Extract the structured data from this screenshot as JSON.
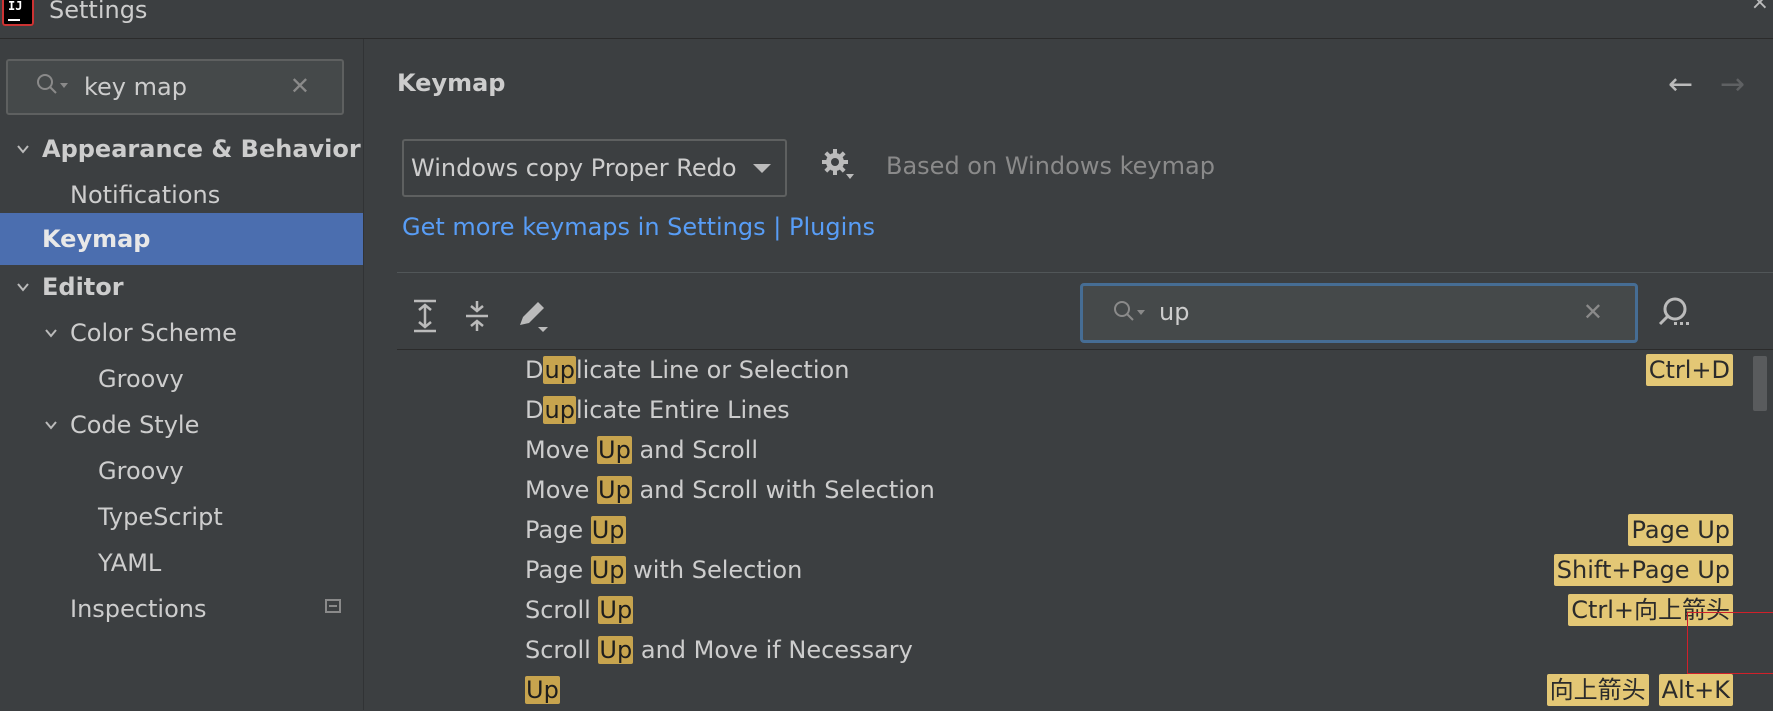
{
  "window": {
    "title": "Settings",
    "logo_text": "IJ"
  },
  "sidebar": {
    "search": {
      "value": "key map"
    },
    "items": [
      {
        "label": "Appearance & Behavior",
        "level": 0,
        "bold": true,
        "expanded": true
      },
      {
        "label": "Notifications",
        "level": 1
      },
      {
        "label": "Keymap",
        "level": 0,
        "bold": true,
        "selected": true
      },
      {
        "label": "Editor",
        "level": 0,
        "bold": true,
        "expanded": true
      },
      {
        "label": "Color Scheme",
        "level": 1,
        "expanded": true
      },
      {
        "label": "Groovy",
        "level": 2
      },
      {
        "label": "Code Style",
        "level": 1,
        "expanded": true
      },
      {
        "label": "Groovy",
        "level": 2
      },
      {
        "label": "TypeScript",
        "level": 2
      },
      {
        "label": "YAML",
        "level": 2
      },
      {
        "label": "Inspections",
        "level": 1
      }
    ]
  },
  "main": {
    "title": "Keymap",
    "keymap_select": "Windows copy Proper Redo",
    "based_on": "Based on Windows keymap",
    "links": {
      "text1": "Get more keymaps in Settings",
      "separator": "|",
      "text2": "Plugins"
    },
    "filter": {
      "value": "up"
    },
    "actions": [
      {
        "parts": [
          "D",
          "up",
          "licate Line or Selection"
        ],
        "shortcuts": [
          "Ctrl+D"
        ]
      },
      {
        "parts": [
          "D",
          "up",
          "licate Entire Lines"
        ],
        "shortcuts": []
      },
      {
        "parts": [
          "Move ",
          "Up",
          " and Scroll"
        ],
        "shortcuts": []
      },
      {
        "parts": [
          "Move ",
          "Up",
          " and Scroll with Selection"
        ],
        "shortcuts": []
      },
      {
        "parts": [
          "Page ",
          "Up",
          ""
        ],
        "shortcuts": [
          "Page Up"
        ]
      },
      {
        "parts": [
          "Page ",
          "Up",
          " with Selection"
        ],
        "shortcuts": [
          "Shift+Page Up"
        ]
      },
      {
        "parts": [
          "Scroll ",
          "Up",
          ""
        ],
        "shortcuts": [
          "Ctrl+向上箭头"
        ]
      },
      {
        "parts": [
          "Scroll ",
          "Up",
          " and Move if Necessary"
        ],
        "shortcuts": []
      },
      {
        "parts": [
          "",
          "Up",
          ""
        ],
        "shortcuts": [
          "向上箭头",
          "Alt+K"
        ]
      }
    ]
  },
  "colors": {
    "background": "#3c3f41",
    "selection": "#4b6eaf",
    "link": "#589df6",
    "highlight": "#c7a44e",
    "focus_border": "#466d94",
    "annotation_box": "#d0202a"
  }
}
